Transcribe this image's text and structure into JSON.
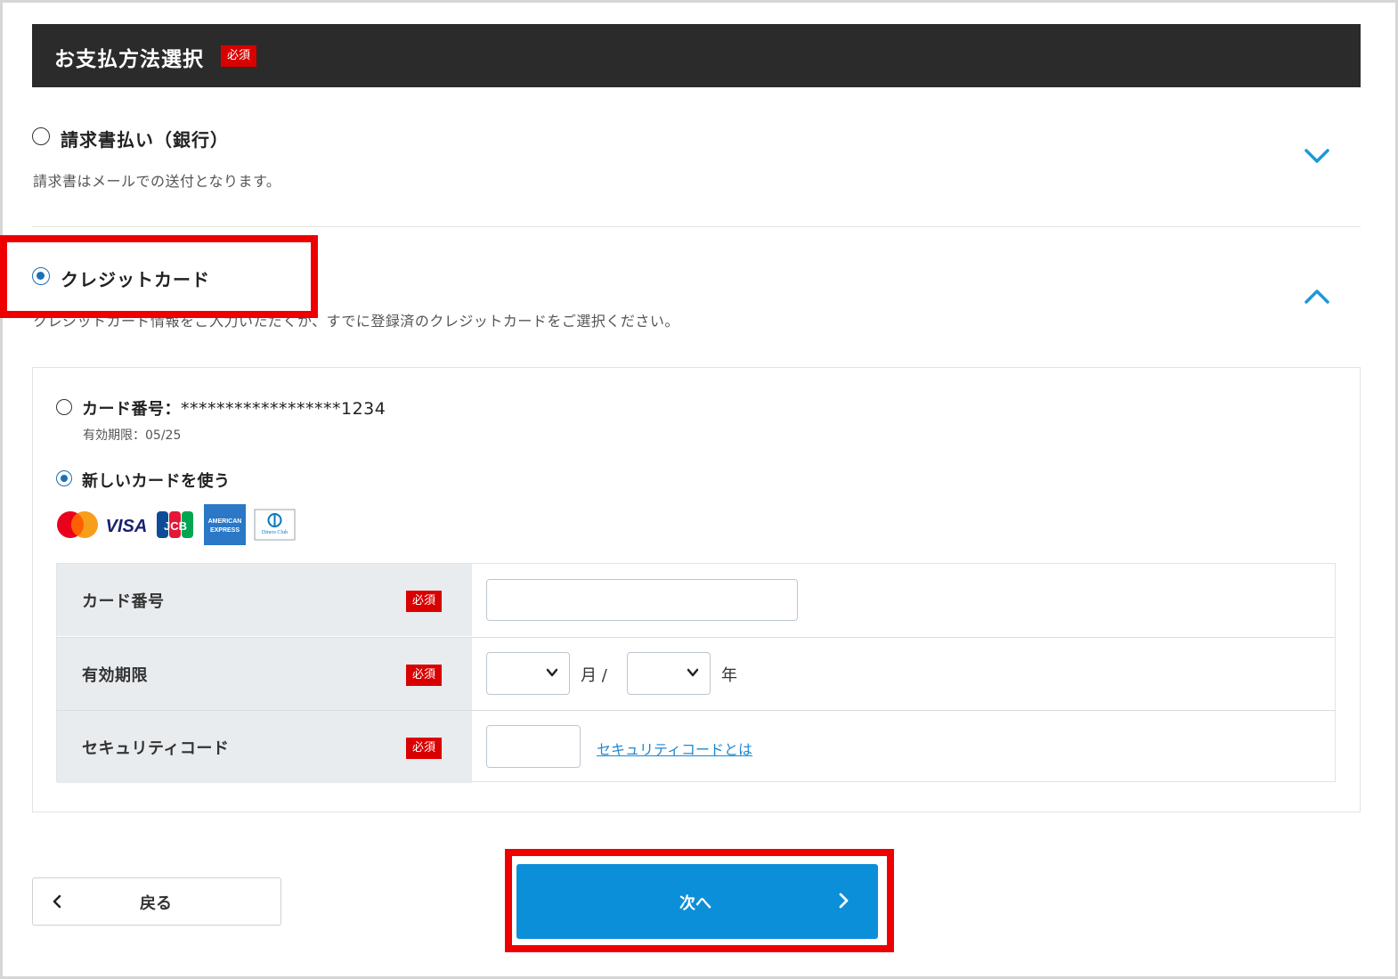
{
  "header": {
    "title": "お支払方法選択",
    "required_badge": "必須"
  },
  "payment_options": [
    {
      "label": "請求書払い（銀行）",
      "description": "請求書はメールでの送付となります。",
      "selected": false
    },
    {
      "label": "クレジットカード",
      "description": "クレジットカード情報をご入力いただくか、すでに登録済のクレジットカードをご選択ください。",
      "selected": true
    }
  ],
  "saved_card": {
    "prefix": "カード番号：",
    "number": "******************1234",
    "expiry": "有効期限：05/25",
    "selected": false
  },
  "new_card": {
    "label": "新しいカードを使う",
    "selected": true
  },
  "card_brands": [
    "mastercard-logo",
    "visa-logo",
    "jcb-logo",
    "amex-logo",
    "diners-club-logo"
  ],
  "brand_text": {
    "visa": "VISA",
    "jcb": "JCB",
    "amex_top": "AMERICAN",
    "amex_bottom": "EXPRESS",
    "diners": "Diners Club"
  },
  "form": {
    "card_number_label": "カード番号",
    "expiry_label": "有効期限",
    "security_code_label": "セキュリティコード",
    "required_badge": "必須",
    "month_unit": "月 /",
    "year_unit": "年",
    "security_link": "セキュリティコードとは",
    "card_number_value": "",
    "security_code_value": ""
  },
  "buttons": {
    "back": "戻る",
    "next": "次へ"
  },
  "colors": {
    "accent": "#0b8fd8",
    "required": "#d90000",
    "highlight": "#ee0000",
    "header_bg": "#2b2b2b"
  }
}
